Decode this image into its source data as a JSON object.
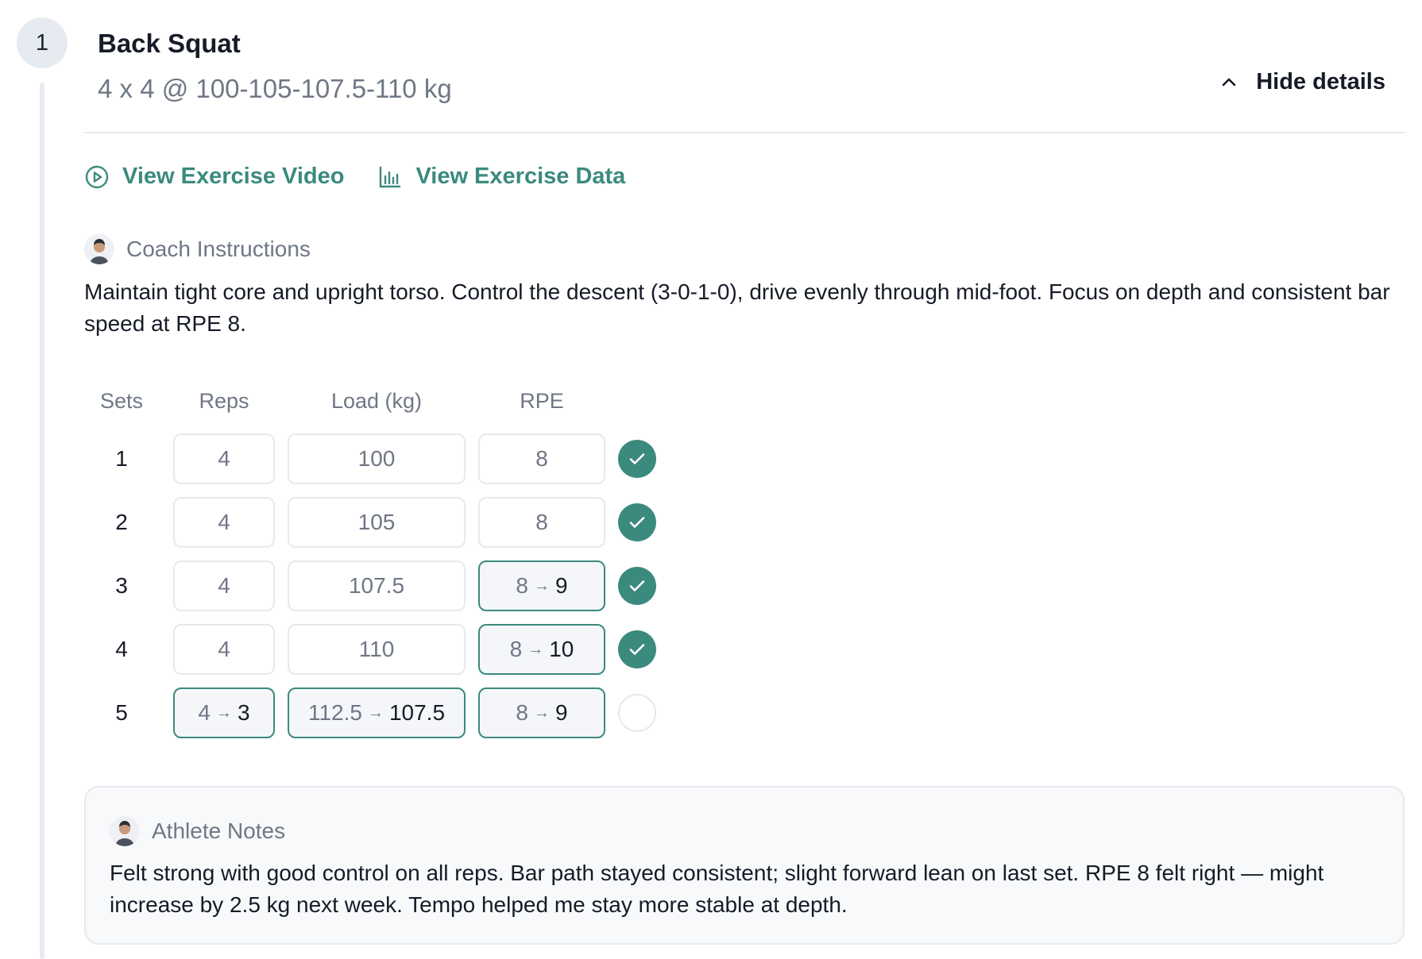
{
  "exercise": {
    "step_number": "1",
    "title": "Back Squat",
    "summary": "4 x 4 @ 100-105-107.5-110 kg",
    "hide_details_label": "Hide details"
  },
  "links": {
    "video_label": "View Exercise Video",
    "data_label": "View Exercise Data"
  },
  "coach": {
    "label": "Coach Instructions",
    "text": "Maintain tight core and upright torso. Control the descent (3-0-1-0), drive evenly through mid-foot. Focus on depth and consistent bar speed at RPE 8."
  },
  "sets_table": {
    "headers": {
      "sets": "Sets",
      "reps": "Reps",
      "load": "Load (kg)",
      "rpe": "RPE"
    },
    "rows": [
      {
        "set": "1",
        "reps": "4",
        "load": "100",
        "rpe": "8",
        "completed": true
      },
      {
        "set": "2",
        "reps": "4",
        "load": "105",
        "rpe": "8",
        "completed": true
      },
      {
        "set": "3",
        "reps": "4",
        "load": "107.5",
        "rpe": "8",
        "rpe_new": "9",
        "completed": true
      },
      {
        "set": "4",
        "reps": "4",
        "load": "110",
        "rpe": "8",
        "rpe_new": "10",
        "completed": true
      },
      {
        "set": "5",
        "reps": "4",
        "reps_new": "3",
        "load": "112.5",
        "load_new": "107.5",
        "rpe": "8",
        "rpe_new": "9",
        "completed": false
      }
    ],
    "change_arrow": "→"
  },
  "athlete": {
    "label": "Athlete Notes",
    "text": "Felt strong with good control on all reps. Bar path stayed consistent; slight forward lean on last set. RPE 8 felt right — might increase by 2.5 kg next week. Tempo helped me stay more stable at depth."
  },
  "icons": {
    "step": "step-number-badge",
    "collapse": "chevron-up-icon",
    "video": "play-circle-icon",
    "data": "bar-chart-icon",
    "coach_avatar": "coach-avatar",
    "athlete_avatar": "athlete-avatar",
    "completed": "check-circle-icon"
  },
  "colors": {
    "accent": "#3b8a7e",
    "muted_text": "#6f7785",
    "border": "#e6e9ee",
    "badge_bg": "#e6ebf2"
  }
}
